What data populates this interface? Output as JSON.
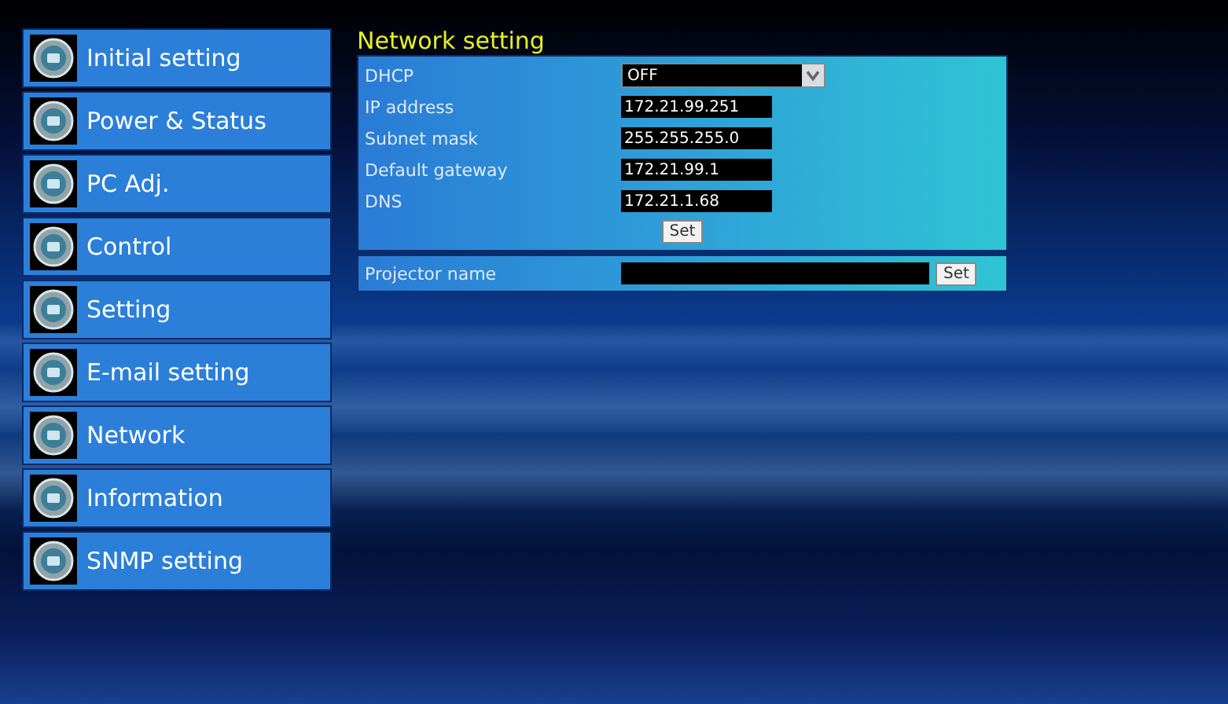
{
  "menu": [
    {
      "label": "Initial setting"
    },
    {
      "label": "Power & Status"
    },
    {
      "label": "PC Adj."
    },
    {
      "label": "Control"
    },
    {
      "label": "Setting"
    },
    {
      "label": "E-mail setting"
    },
    {
      "label": "Network"
    },
    {
      "label": "Information"
    },
    {
      "label": "SNMP setting"
    }
  ],
  "panel": {
    "title": "Network setting",
    "fields": [
      {
        "kind": "select",
        "label": "DHCP",
        "value": "OFF"
      },
      {
        "kind": "text",
        "label": "IP address",
        "value": "172.21.99.251"
      },
      {
        "kind": "text",
        "label": "Subnet mask",
        "value": "255.255.255.0"
      },
      {
        "kind": "text",
        "label": "Default gateway",
        "value": "172.21.99.1"
      },
      {
        "kind": "text",
        "label": "DNS",
        "value": "172.21.1.68"
      }
    ],
    "set_button": "Set",
    "projector": {
      "label": "Projector name",
      "button": "Set"
    }
  }
}
